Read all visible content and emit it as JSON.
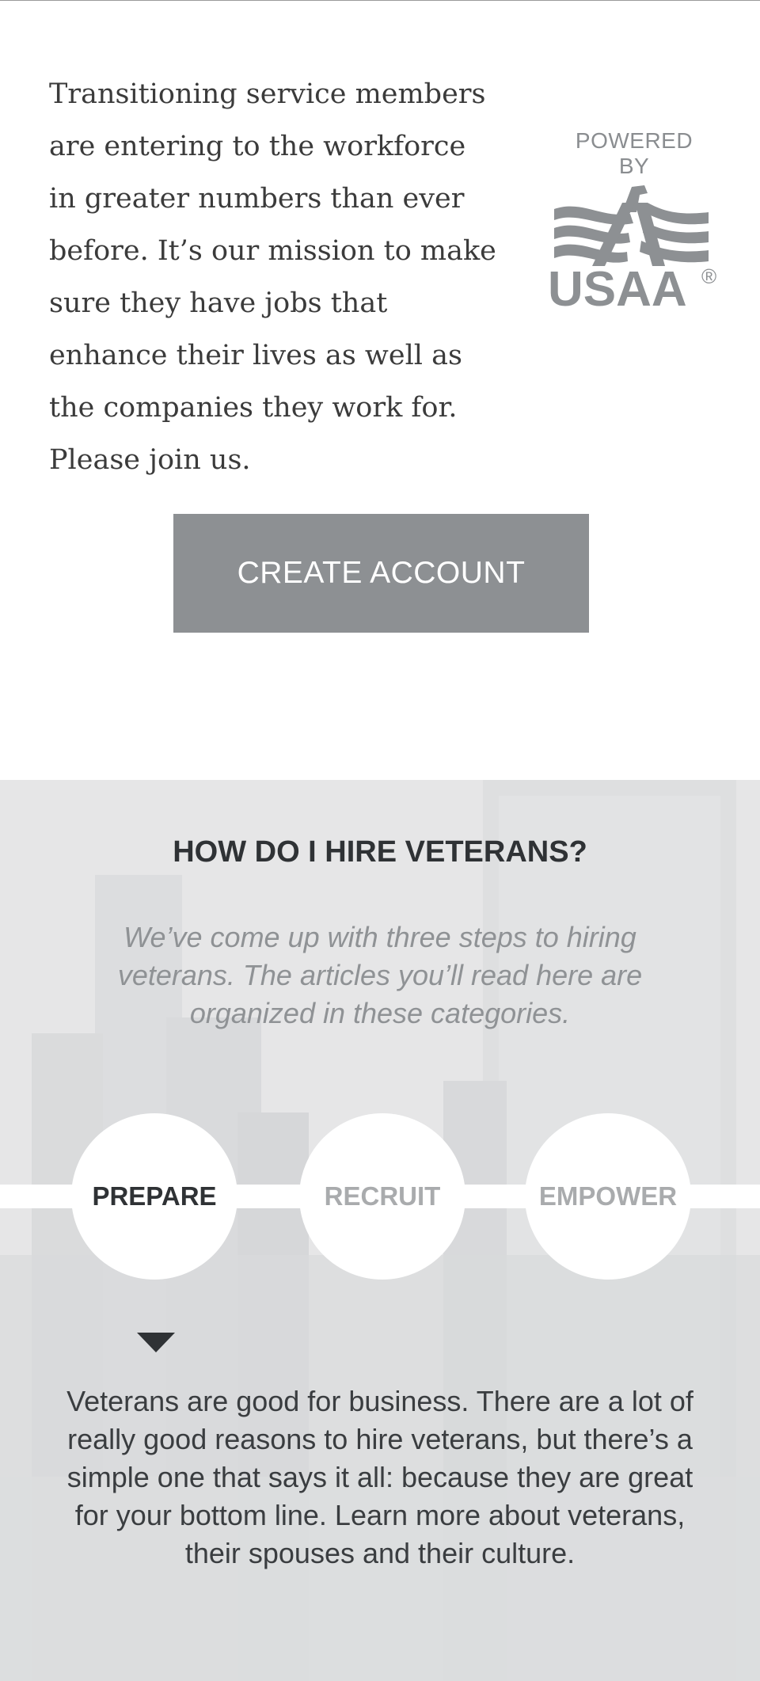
{
  "intro": {
    "text": "Transitioning service members are entering to the workforce in greater numbers than ever before. It’s our mission to make sure they have jobs that enhance their lives as well as the companies they work for. Please join us."
  },
  "sponsor": {
    "powered_by": "POWERED BY",
    "logo_text": "USAA",
    "logo_icon": "usaa-eagle-logo",
    "registered_mark": "®"
  },
  "cta": {
    "label": "CREATE ACCOUNT"
  },
  "hire": {
    "title": "HOW DO I HIRE VETERANS?",
    "subtitle": "We’ve come up with three steps to hiring veterans. The articles you’ll read here are organized in these categories.",
    "steps": [
      {
        "label": "PREPARE",
        "active": true
      },
      {
        "label": "RECRUIT",
        "active": false
      },
      {
        "label": "EMPOWER",
        "active": false
      }
    ],
    "active_description": "Veterans are good for business. There are a lot of really good reasons to hire veterans, but there’s a simple one that says it all: because they are great for your bottom line. Learn more about veterans, their spouses and their culture."
  },
  "colors": {
    "button_gray": "#8d9093",
    "heading_dark": "#2f3235",
    "muted_gray": "#8f9295",
    "section_bg": "#e9e9ea"
  }
}
